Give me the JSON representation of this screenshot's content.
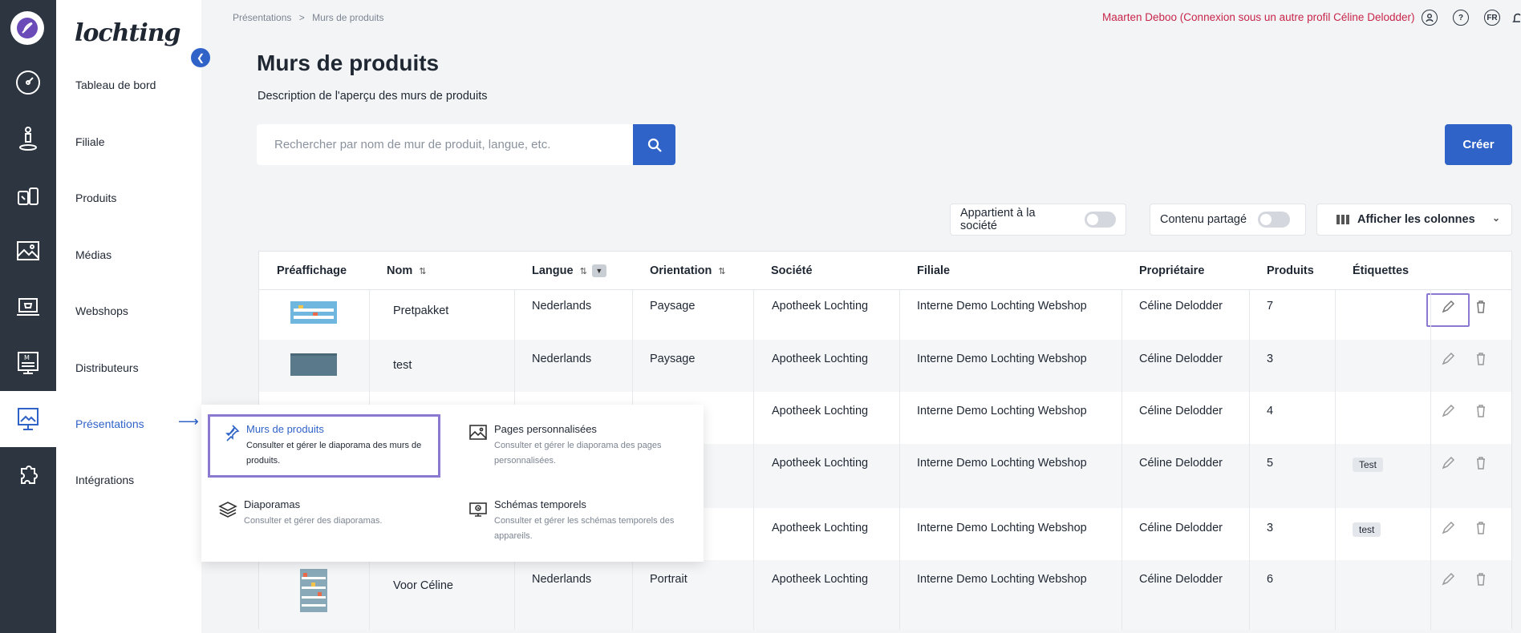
{
  "brand": "lochting",
  "menu": {
    "items": [
      {
        "label": "Tableau de bord"
      },
      {
        "label": "Filiale"
      },
      {
        "label": "Produits"
      },
      {
        "label": "Médias"
      },
      {
        "label": "Webshops"
      },
      {
        "label": "Distributeurs"
      },
      {
        "label": "Présentations"
      },
      {
        "label": "Intégrations"
      }
    ]
  },
  "breadcrumb": [
    "Présentations",
    ">",
    "Murs de produits"
  ],
  "header": {
    "user_text": "Maarten Deboo (Connexion sous un autre profil Céline Delodder)",
    "lang": "FR"
  },
  "page": {
    "title": "Murs de produits",
    "description": "Description de l'aperçu des murs de produits"
  },
  "search": {
    "placeholder": "Rechercher par nom de mur de produit, langue, etc.",
    "value": ""
  },
  "create_label": "Créer",
  "filters": {
    "company": "Appartient à la société",
    "shared": "Contenu partagé",
    "columns": "Afficher les colonnes"
  },
  "table": {
    "headers": [
      "Préaffichage",
      "Nom",
      "Langue",
      "Orientation",
      "Société",
      "Filiale",
      "Propriétaire",
      "Produits",
      "Étiquettes"
    ],
    "rows": [
      {
        "name": "Pretpakket",
        "lang": "Nederlands",
        "orientation": "Paysage",
        "company": "Apotheek Lochting",
        "branch": "Interne Demo Lochting Webshop",
        "owner": "Céline Delodder",
        "products": "7",
        "tag": ""
      },
      {
        "name": "test",
        "lang": "Nederlands",
        "orientation": "Paysage",
        "company": "Apotheek Lochting",
        "branch": "Interne Demo Lochting Webshop",
        "owner": "Céline Delodder",
        "products": "3",
        "tag": ""
      },
      {
        "name": "",
        "lang": "",
        "orientation": "",
        "company": "Apotheek Lochting",
        "branch": "Interne Demo Lochting Webshop",
        "owner": "Céline Delodder",
        "products": "4",
        "tag": ""
      },
      {
        "name": "",
        "lang": "",
        "orientation": "",
        "company": "Apotheek Lochting",
        "branch": "Interne Demo Lochting Webshop",
        "owner": "Céline Delodder",
        "products": "5",
        "tag": "Test"
      },
      {
        "name": "",
        "lang": "",
        "orientation": "",
        "company": "Apotheek Lochting",
        "branch": "Interne Demo Lochting Webshop",
        "owner": "Céline Delodder",
        "products": "3",
        "tag": "test"
      },
      {
        "name": "Voor Céline",
        "lang": "Nederlands",
        "orientation": "Portrait",
        "company": "Apotheek Lochting",
        "branch": "Interne Demo Lochting Webshop",
        "owner": "Céline Delodder",
        "products": "6",
        "tag": ""
      }
    ]
  },
  "dropdown": {
    "items": [
      {
        "title": "Murs de produits",
        "desc": "Consulter et gérer le diaporama des murs de produits.",
        "icon": "pin-icon"
      },
      {
        "title": "Pages personnalisées",
        "desc": "Consulter et gérer le diaporama des pages personnalisées.",
        "icon": "image-icon"
      },
      {
        "title": "Diaporamas",
        "desc": "Consulter et gérer des diaporamas.",
        "icon": "layers-icon"
      },
      {
        "title": "Schémas temporels",
        "desc": "Consulter et gérer les schémas temporels des appareils.",
        "icon": "schedule-icon"
      }
    ]
  },
  "colors": {
    "accent": "#2f63c8",
    "rail": "#2c3540",
    "user": "#c8254a",
    "focus": "#8b78d0"
  }
}
